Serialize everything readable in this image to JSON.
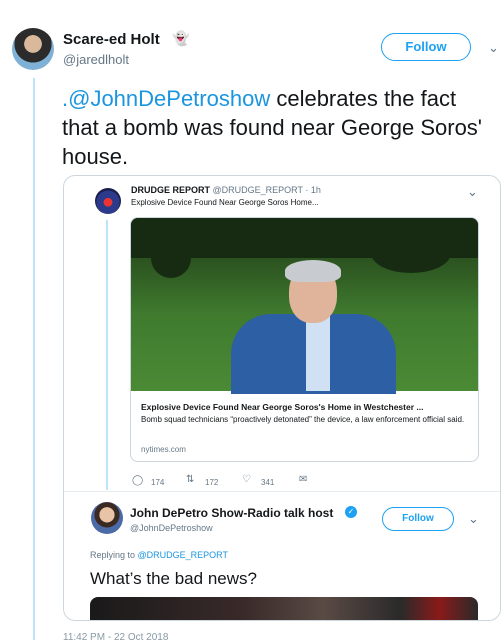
{
  "author": {
    "name": "Scare-ed Holt",
    "emoji": "👻",
    "handle": "@jaredlholt"
  },
  "follow_label": "Follow",
  "tweet": {
    "mention": ".@JohnDePetroshow",
    "text": " celebrates the fact that a bomb was found near George Soros' house."
  },
  "quoted": {
    "source_name": "DRUDGE REPORT",
    "source_handle": "@DRUDGE_REPORT · 1h",
    "source_text": "Explosive Device Found Near George Soros Home...",
    "link_title": "Explosive Device Found Near George Soros's Home in Westchester ...",
    "link_desc": "Bomb squad technicians “proactively detonated” the device, a law enforcement official said.",
    "link_domain": "nytimes.com",
    "replies": "174",
    "retweets": "172",
    "likes": "341"
  },
  "reply": {
    "name": "John DePetro Show-Radio talk host",
    "handle": "@JohnDePetroshow",
    "follow_label": "Follow",
    "replying_prefix": "Replying to ",
    "replying_to": "@DRUDGE_REPORT",
    "text": "What’s the bad news?"
  },
  "timestamp": "11:42 PM - 22 Oct 2018",
  "colors": {
    "accent": "#1da1f2",
    "link": "#1b95e0",
    "muted": "#657786"
  }
}
